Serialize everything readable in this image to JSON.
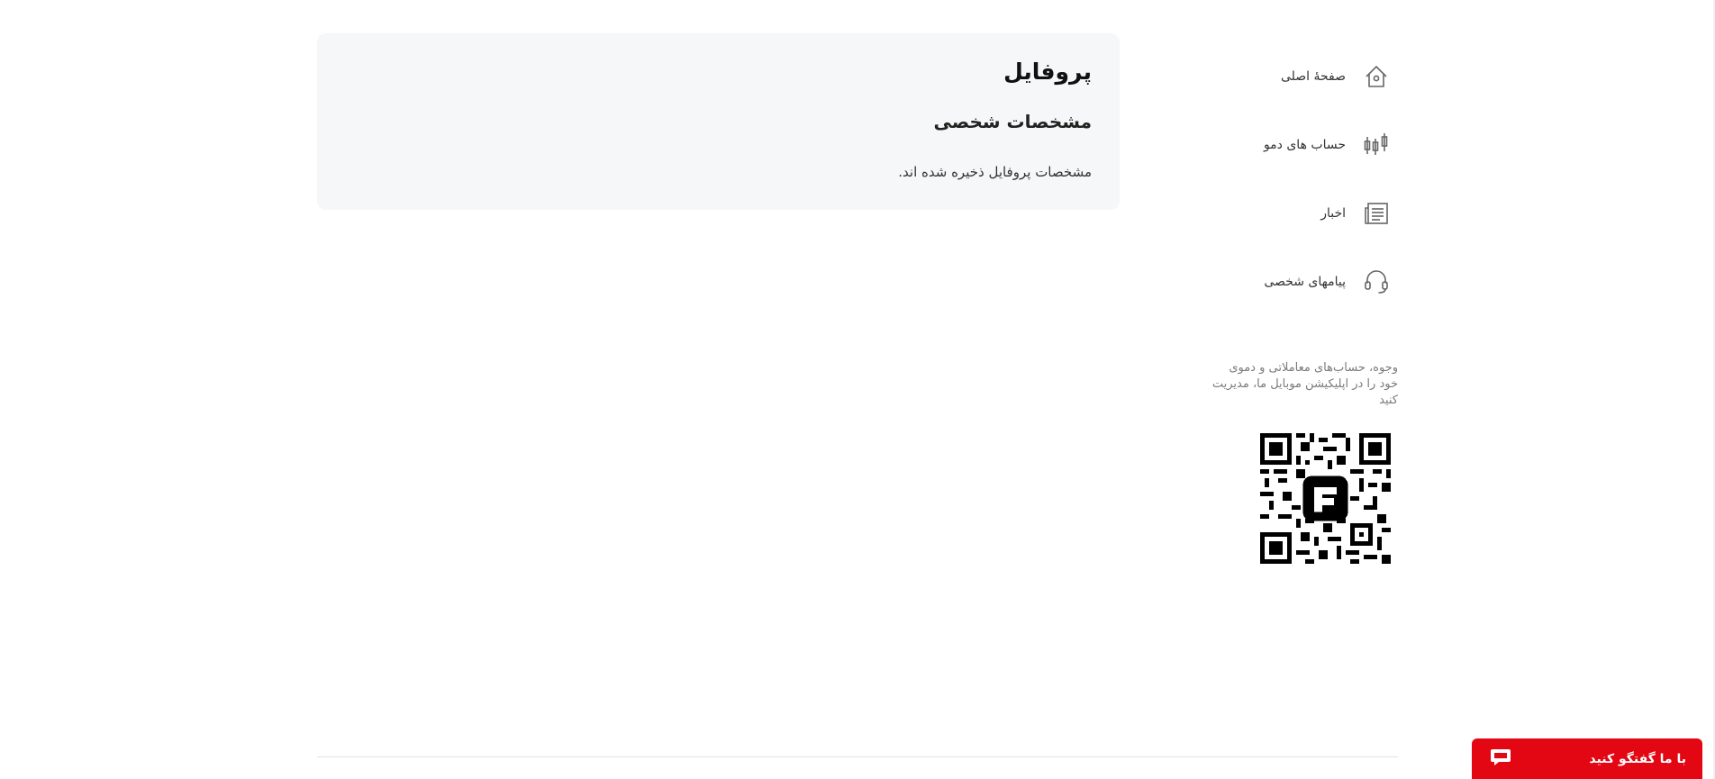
{
  "profile": {
    "title": "پروفایل",
    "section_title": "مشخصات شخصی",
    "saved_message": "مشخصات پروفایل ذخیره شده اند."
  },
  "sidebar": {
    "items": [
      {
        "label": "صفحهٔ اصلی",
        "icon": "home-icon"
      },
      {
        "label": "حساب های دمو",
        "icon": "candlestick-icon"
      },
      {
        "label": "اخبار",
        "icon": "news-icon"
      },
      {
        "label": "پیامهای شخصی",
        "icon": "headset-icon"
      }
    ]
  },
  "app_promo": {
    "text": "وجوه، حساب‌های معاملاتی و دموی خود را در اپلیکیشن موبایل ما، مدیریت کنید",
    "qr_icon": "qr-code-icon"
  },
  "chat": {
    "label": "با ما گفتگو کنید",
    "icon": "chat-bubble-icon",
    "color": "#e30613"
  }
}
